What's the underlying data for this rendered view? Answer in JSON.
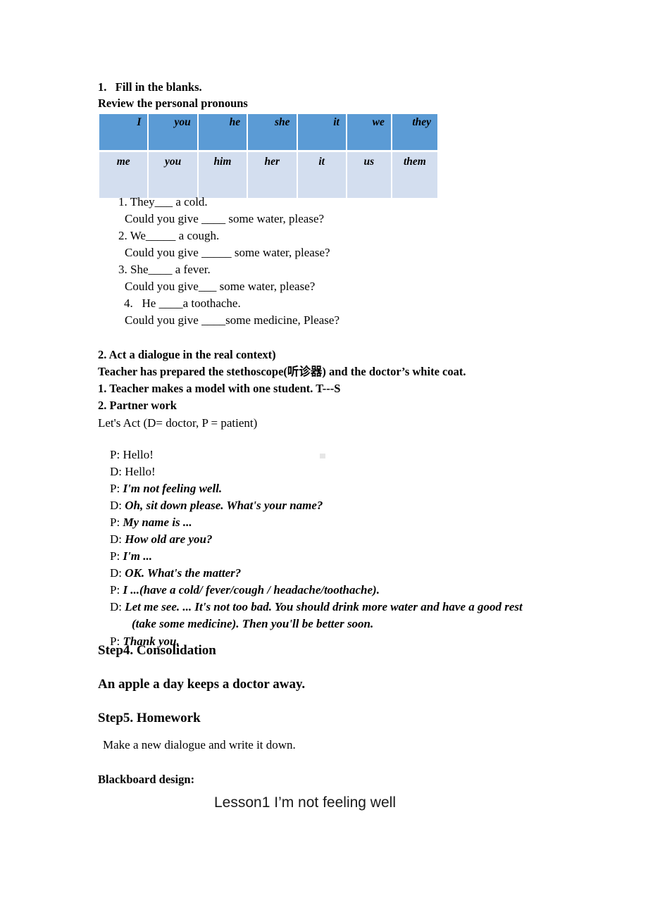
{
  "section1": {
    "title": "1.   Fill in the blanks.",
    "subtitle": "Review the personal pronouns",
    "table": {
      "subject_row": [
        "I",
        "you",
        "he",
        "she",
        "it",
        "we",
        "they"
      ],
      "object_row": [
        "me",
        "you",
        "him",
        "her",
        "it",
        "us",
        "them"
      ],
      "subject_row_color": "#5B9BD5",
      "object_row_color": "#D3DEEF"
    },
    "exercises": [
      {
        "prompt": "1. They___ a cold.",
        "question": "Could you give ____ some water, please?"
      },
      {
        "prompt": "2. We_____ a cough.",
        "question": "Could you give _____ some water, please?"
      },
      {
        "prompt": "3. She____ a fever.",
        "question": "Could you give___ some water, please?"
      },
      {
        "prompt": "4.   He ____a toothache.",
        "question": "Could you give ____some medicine, Please?"
      }
    ]
  },
  "section2": {
    "title": "2. Act a dialogue in the real context)",
    "preparation": "Teacher has prepared the stethoscope(听诊器) and the doctor’s white coat.",
    "step_model": "1. Teacher makes a model with one student. T---S",
    "step_partner": "2. Partner work",
    "intro": "Let's Act (D= doctor, P = patient)",
    "dialogue": [
      {
        "speaker": "P: ",
        "text": "Hello!",
        "emphasis": false
      },
      {
        "speaker": "D: ",
        "text": "Hello!",
        "emphasis": false
      },
      {
        "speaker": "P: ",
        "text": "I'm not feeling well.",
        "emphasis": true
      },
      {
        "speaker": "D: ",
        "text": "Oh, sit down please. What's your name?",
        "emphasis": true
      },
      {
        "speaker": "P: ",
        "text": "My name is ...",
        "emphasis": true
      },
      {
        "speaker": "D: ",
        "text": "How old are you?",
        "emphasis": true
      },
      {
        "speaker": "P: ",
        "text": "I'm ...",
        "emphasis": true
      },
      {
        "speaker": "D: ",
        "text": "OK. What's the matter?",
        "emphasis": true
      },
      {
        "speaker": "P: ",
        "text": "I ...(have a cold/ fever/cough / headache/toothache).",
        "emphasis": true
      },
      {
        "speaker": "D: ",
        "text": "Let me see. ... It's not too bad. You should drink more water and have a good rest",
        "emphasis": true
      },
      {
        "speaker": "",
        "text": "(take some medicine). Then you'll be better soon.",
        "emphasis": true
      },
      {
        "speaker": "P: ",
        "text": "Thank you.",
        "emphasis": true
      }
    ]
  },
  "step4": {
    "heading": "Step4. Consolidation",
    "proverb": "An apple a day keeps a doctor away."
  },
  "step5": {
    "heading": "Step5. Homework",
    "task": "Make a new dialogue and write it down."
  },
  "blackboard": {
    "label": "Blackboard design:",
    "text": "Lesson1 I’m not feeling well"
  }
}
